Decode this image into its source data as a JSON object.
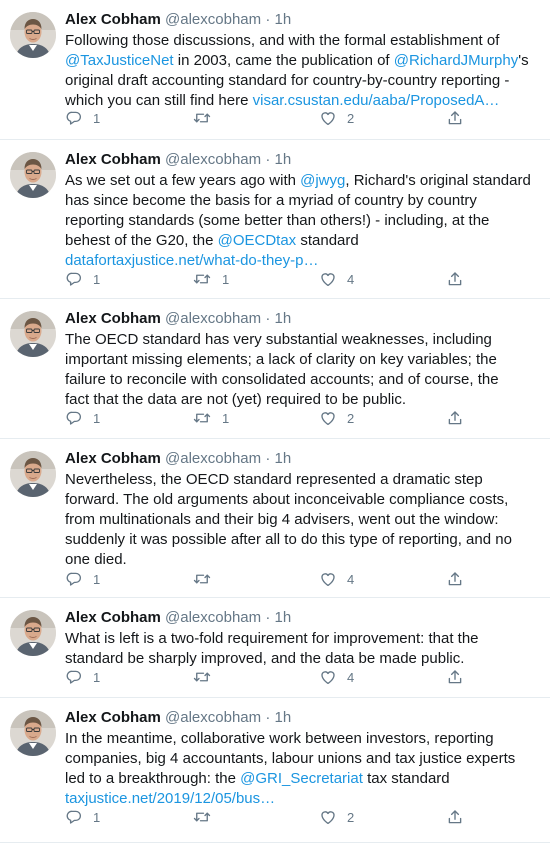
{
  "tweets": [
    {
      "name": "Alex Cobham",
      "handle": "@alexcobham",
      "dot": "·",
      "time": "1h",
      "lines": [
        [
          {
            "t": "Following those discussions, and with the formal establishment of"
          }
        ],
        [
          {
            "t": "@TaxJusticeNet",
            "link": true
          },
          {
            "t": " in 2003, came the publication of "
          },
          {
            "t": "@RichardJMurphy",
            "link": true
          },
          {
            "t": "'s"
          }
        ],
        [
          {
            "t": "original draft accounting standard for country-by-country reporting -"
          }
        ],
        [
          {
            "t": "which you can still find here "
          },
          {
            "t": "visar.csustan.edu/aaba/ProposedA…",
            "link": true
          }
        ]
      ],
      "replies": "1",
      "retweets": "",
      "likes": "2"
    },
    {
      "name": "Alex Cobham",
      "handle": "@alexcobham",
      "dot": "·",
      "time": "1h",
      "lines": [
        [
          {
            "t": "As we set out a few years ago with "
          },
          {
            "t": "@jwyg",
            "link": true
          },
          {
            "t": ", Richard's original standard"
          }
        ],
        [
          {
            "t": "has since become the basis for a myriad of country by country"
          }
        ],
        [
          {
            "t": "reporting standards (some better than others!) - including, at the"
          }
        ],
        [
          {
            "t": "behest of the G20, the "
          },
          {
            "t": "@OECDtax",
            "link": true
          },
          {
            "t": " standard"
          }
        ],
        [
          {
            "t": "datafortaxjustice.net/what-do-they-p…",
            "link": true
          }
        ]
      ],
      "replies": "1",
      "retweets": "1",
      "likes": "4"
    },
    {
      "name": "Alex Cobham",
      "handle": "@alexcobham",
      "dot": "·",
      "time": "1h",
      "lines": [
        [
          {
            "t": "The OECD standard has very substantial weaknesses, including"
          }
        ],
        [
          {
            "t": "important missing elements; a lack of clarity on key variables; the"
          }
        ],
        [
          {
            "t": "failure to reconcile with consolidated accounts; and of course, the"
          }
        ],
        [
          {
            "t": "fact that the data are not (yet) required to be public."
          }
        ]
      ],
      "replies": "1",
      "retweets": "1",
      "likes": "2"
    },
    {
      "name": "Alex Cobham",
      "handle": "@alexcobham",
      "dot": "·",
      "time": "1h",
      "lines": [
        [
          {
            "t": "Nevertheless, the OECD standard represented a dramatic step"
          }
        ],
        [
          {
            "t": "forward. The old arguments about inconceivable compliance costs,"
          }
        ],
        [
          {
            "t": "from multinationals and their big 4 advisers, went out the window:"
          }
        ],
        [
          {
            "t": "suddenly it was possible after all to do this type of reporting, and no"
          }
        ],
        [
          {
            "t": "one died."
          }
        ]
      ],
      "replies": "1",
      "retweets": "",
      "likes": "4"
    },
    {
      "name": "Alex Cobham",
      "handle": "@alexcobham",
      "dot": "·",
      "time": "1h",
      "lines": [
        [
          {
            "t": "What is left is a two-fold requirement for improvement: that the"
          }
        ],
        [
          {
            "t": "standard be sharply improved, and the data be made public."
          }
        ]
      ],
      "replies": "1",
      "retweets": "",
      "likes": "4"
    },
    {
      "name": "Alex Cobham",
      "handle": "@alexcobham",
      "dot": "·",
      "time": "1h",
      "lines": [
        [
          {
            "t": "In the meantime, collaborative work between investors, reporting"
          }
        ],
        [
          {
            "t": "companies, big 4 accountants, labour unions and tax justice experts"
          }
        ],
        [
          {
            "t": "led to a breakthrough: the "
          },
          {
            "t": "@GRI_Secretariat",
            "link": true
          },
          {
            "t": " tax standard"
          }
        ],
        [
          {
            "t": "taxjustice.net/2019/12/05/bus…",
            "link": true
          }
        ]
      ],
      "replies": "1",
      "retweets": "",
      "likes": "2"
    }
  ],
  "colors": {
    "text": "#14171a",
    "secondary": "#657786",
    "link": "#1b95e0",
    "divider": "#e6ecf0"
  },
  "icons": {
    "reply": "reply-icon",
    "retweet": "retweet-icon",
    "like": "heart-icon",
    "share": "share-icon"
  }
}
